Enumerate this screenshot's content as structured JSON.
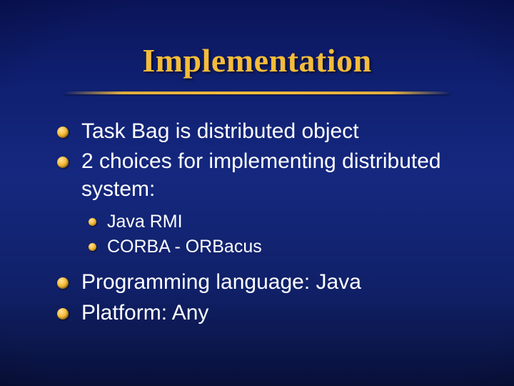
{
  "title": "Implementation",
  "bullets": {
    "b1": "Task Bag is distributed object",
    "b2": "2 choices for implementing distributed system:",
    "b2_sub": {
      "s1": "Java RMI",
      "s2": "CORBA - ORBacus"
    },
    "b3": "Programming language: Java",
    "b4": "Platform: Any"
  }
}
